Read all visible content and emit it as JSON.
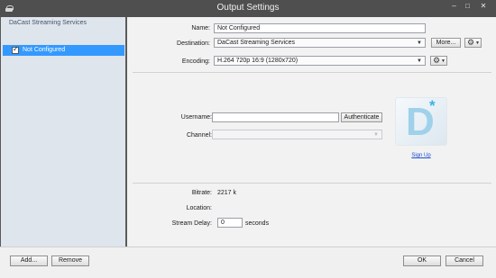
{
  "window": {
    "title": "Output Settings",
    "minimize_glyph": "–",
    "maximize_glyph": "□",
    "close_glyph": "✕"
  },
  "sidebar": {
    "header": "DaCast Streaming Services",
    "items": [
      {
        "label": "Not Configured",
        "checked": true,
        "selected": true
      }
    ]
  },
  "form": {
    "name": {
      "label": "Name:",
      "value": "Not Configured"
    },
    "destination": {
      "label": "Destination:",
      "value": "DaCast Streaming Services",
      "more_label": "More..."
    },
    "encoding": {
      "label": "Encoding:",
      "value": "H.264 720p 16:9 (1280x720)"
    },
    "username": {
      "label": "Username:",
      "value": "",
      "authenticate_label": "Authenticate"
    },
    "channel": {
      "label": "Channel:",
      "value": ""
    },
    "logo": {
      "letter": "D",
      "star": "*"
    },
    "signup_label": "Sign Up",
    "bitrate": {
      "label": "Bitrate:",
      "value": "2217 k"
    },
    "location": {
      "label": "Location:",
      "value": ""
    },
    "stream_delay": {
      "label": "Stream Delay:",
      "value": "0",
      "unit": "seconds"
    }
  },
  "footer": {
    "add_label": "Add...",
    "remove_label": "Remove",
    "ok_label": "OK",
    "cancel_label": "Cancel"
  },
  "icons": {
    "gear": "gear-icon",
    "dropdown": "chevron-down-icon",
    "checkbox": "check-icon"
  },
  "colors": {
    "selection": "#3399ff",
    "titlebar": "#4f4f4f",
    "link": "#1a4fd0",
    "logo_accent": "#39b4e3"
  }
}
